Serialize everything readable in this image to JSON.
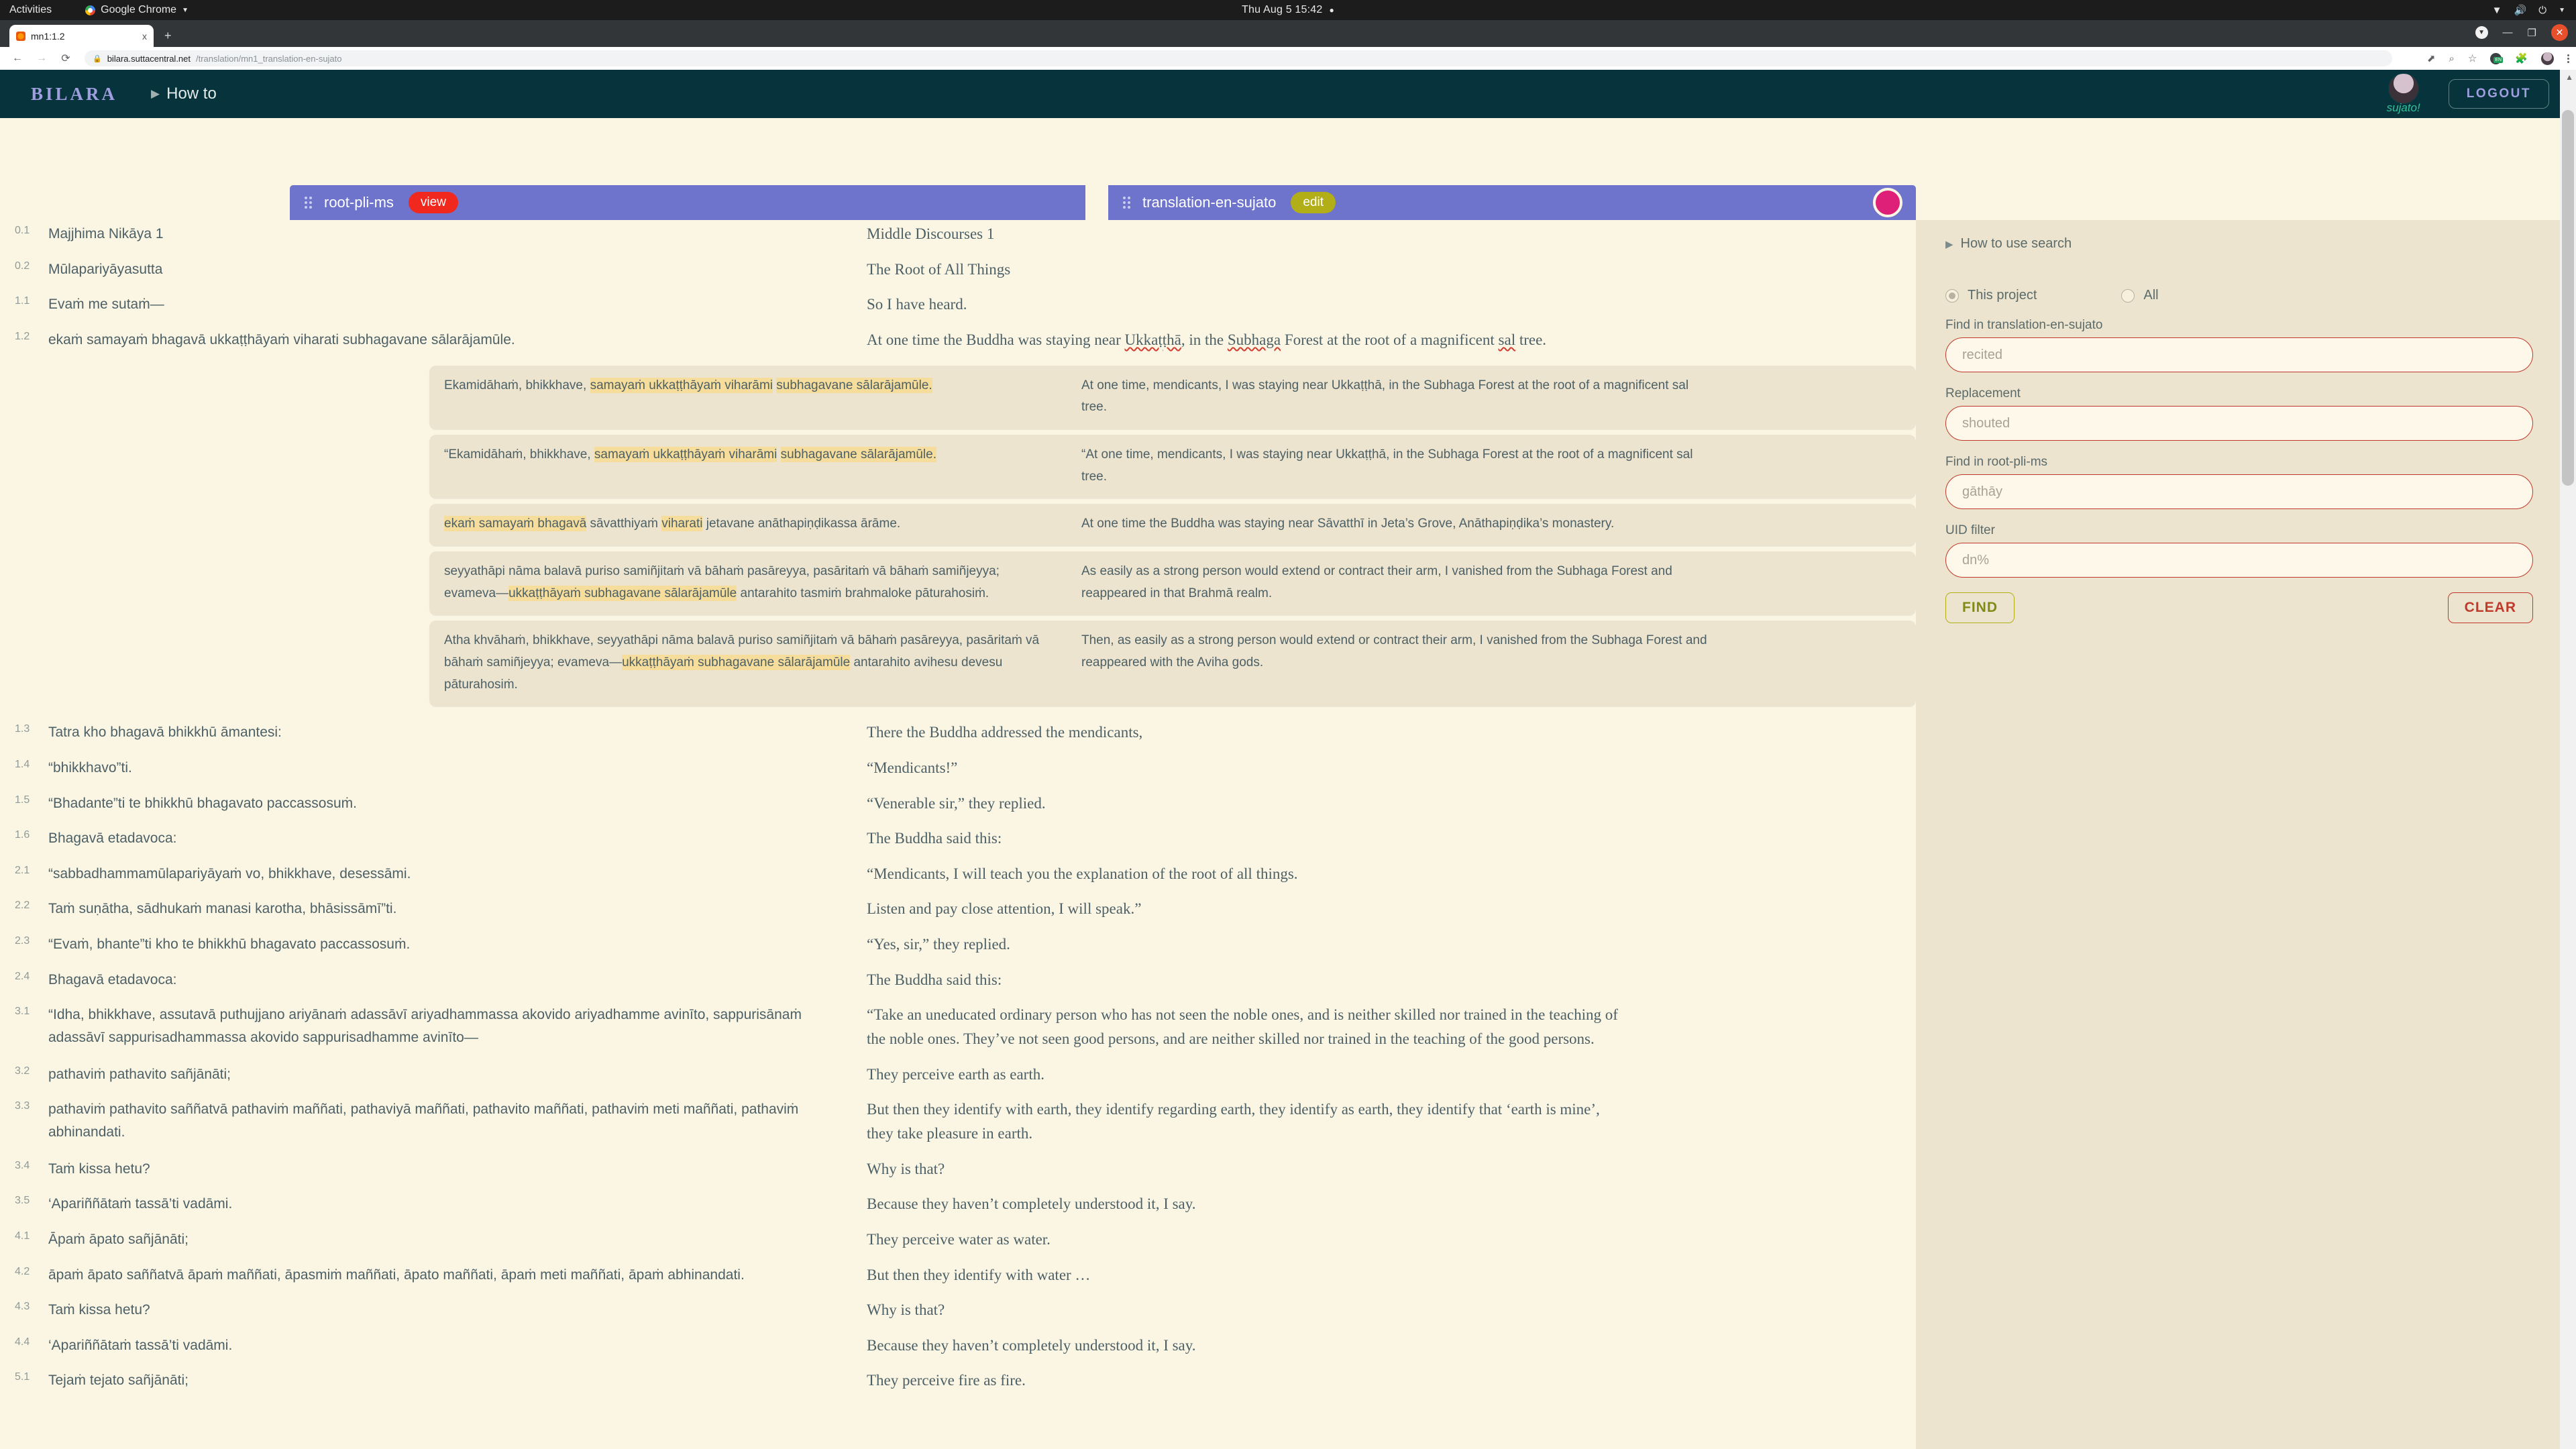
{
  "os": {
    "activities": "Activities",
    "app_menu": "Google Chrome",
    "clock": "Thu Aug 5  15:42",
    "icons": {
      "wifi": "wifi-icon",
      "volume": "volume-icon",
      "power": "power-icon",
      "chevron": "chevron-down-icon"
    }
  },
  "browser": {
    "tab_title": "mn1:1.2",
    "tab_close": "x",
    "new_tab": "+",
    "url_host": "bilara.suttacentral.net",
    "url_path": "/translation/mn1_translation-en-sujato",
    "window": {
      "minimize": "—",
      "maximize": "❐",
      "close": "✕"
    }
  },
  "app": {
    "brand": "BILARA",
    "howto": "How to",
    "user_name": "sujato!",
    "logout_label": "LOGOUT"
  },
  "columns": {
    "left": {
      "title": "root-pli-ms",
      "badge": "view"
    },
    "right": {
      "title": "translation-en-sujato",
      "badge": "edit"
    }
  },
  "sidebar": {
    "howto_search": "How to use search",
    "scope": {
      "this_project": "This project",
      "all": "All",
      "selected": "This project"
    },
    "find_translation_label": "Find in translation-en-sujato",
    "find_translation_placeholder": "recited",
    "replacement_label": "Replacement",
    "replacement_placeholder": "shouted",
    "find_root_label": "Find in root-pli-ms",
    "find_root_placeholder": "gāthāy",
    "uid_label": "UID filter",
    "uid_placeholder": "dn%",
    "find_button": "FIND",
    "clear_button": "CLEAR"
  },
  "segments_top": [
    {
      "num": "0.1",
      "pli": "Majjhima Nikāya 1",
      "en": "Middle Discourses 1"
    },
    {
      "num": "0.2",
      "pli": "Mūlapariyāyasutta",
      "en": "The Root of All Things"
    },
    {
      "num": "1.1",
      "pli": "Evaṁ me sutaṁ—",
      "en": "So I have heard."
    },
    {
      "num": "1.2",
      "pli": "ekaṁ samayaṁ bhagavā ukkaṭṭhāyaṁ viharati subhagavane sālarājamūle.",
      "en": "At one time the Buddha was staying near Ukkaṭṭhā, in the Subhaga Forest at the root of a magnificent sal tree."
    }
  ],
  "search_results": [
    {
      "pli_parts": [
        {
          "t": "Ekamidāhaṁ, bhikkhave, ",
          "hl": false
        },
        {
          "t": "samayaṁ ukkaṭṭhāyaṁ viharāmi",
          "hl": true
        },
        {
          "t": " ",
          "hl": false
        },
        {
          "t": "subhagavane sālarājamūle.",
          "hl": true
        }
      ],
      "en": "At one time, mendicants, I was staying near Ukkaṭṭhā, in the Subhaga Forest at the root of a magnificent sal tree."
    },
    {
      "pli_parts": [
        {
          "t": "“Ekamidāhaṁ, bhikkhave, ",
          "hl": false
        },
        {
          "t": "samayaṁ ukkaṭṭhāyaṁ viharāmi",
          "hl": true
        },
        {
          "t": " ",
          "hl": false
        },
        {
          "t": "subhagavane sālarājamūle.",
          "hl": true
        }
      ],
      "en": "“At one time, mendicants, I was staying near Ukkaṭṭhā, in the Subhaga Forest at the root of a magnificent sal tree."
    },
    {
      "pli_parts": [
        {
          "t": "ekaṁ samayaṁ bhagavā",
          "hl": true
        },
        {
          "t": " sāvatthiyaṁ ",
          "hl": false
        },
        {
          "t": "viharati",
          "hl": true
        },
        {
          "t": " jetavane anāthapiṇḍikassa ārāme.",
          "hl": false
        }
      ],
      "en": "At one time the Buddha was staying near Sāvatthī in Jeta’s Grove, Anāthapiṇḍika’s monastery."
    },
    {
      "pli_parts": [
        {
          "t": "seyyathāpi nāma balavā puriso samiñjitaṁ vā bāhaṁ pasāreyya, pasāritaṁ vā bāhaṁ samiñjeyya; evameva—",
          "hl": false
        },
        {
          "t": "ukkaṭṭhāyaṁ subhagavane sālarājamūle",
          "hl": true
        },
        {
          "t": " antarahito tasmiṁ brahmaloke pāturahosiṁ.",
          "hl": false
        }
      ],
      "en": "As easily as a strong person would extend or contract their arm, I vanished from the Subhaga Forest and reappeared in that Brahmā realm."
    },
    {
      "pli_parts": [
        {
          "t": "Atha khvāhaṁ, bhikkhave, seyyathāpi nāma balavā puriso samiñjitaṁ vā bāhaṁ pasāreyya, pasāritaṁ vā bāhaṁ samiñjeyya; evameva—",
          "hl": false
        },
        {
          "t": "ukkaṭṭhāyaṁ subhagavane sālarājamūle",
          "hl": true
        },
        {
          "t": " antarahito avihesu devesu pāturahosiṁ.",
          "hl": false
        }
      ],
      "en": "Then, as easily as a strong person would extend or contract their arm, I vanished from the Subhaga Forest and reappeared with the Aviha gods."
    }
  ],
  "segments_bottom": [
    {
      "num": "1.3",
      "pli": "Tatra kho bhagavā bhikkhū āmantesi:",
      "en": "There the Buddha addressed the mendicants,"
    },
    {
      "num": "1.4",
      "pli": "“bhikkhavo”ti.",
      "en": "“Mendicants!”"
    },
    {
      "num": "1.5",
      "pli": "“Bhadante”ti te bhikkhū bhagavato paccassosuṁ.",
      "en": "“Venerable sir,” they replied."
    },
    {
      "num": "1.6",
      "pli": "Bhagavā etadavoca:",
      "en": "The Buddha said this:"
    },
    {
      "num": "2.1",
      "pli": "“sabbadhammamūlapariyāyaṁ vo, bhikkhave, desessāmi.",
      "en": "“Mendicants, I will teach you the explanation of the root of all things."
    },
    {
      "num": "2.2",
      "pli": "Taṁ suṇātha, sādhukaṁ manasi karotha, bhāsissāmī”ti.",
      "en": "Listen and pay close attention, I will speak.”"
    },
    {
      "num": "2.3",
      "pli": "“Evaṁ, bhante”ti kho te bhikkhū bhagavato paccassosuṁ.",
      "en": "“Yes, sir,” they replied."
    },
    {
      "num": "2.4",
      "pli": "Bhagavā etadavoca:",
      "en": "The Buddha said this:"
    },
    {
      "num": "3.1",
      "pli": "“Idha, bhikkhave, assutavā puthujjano ariyānaṁ adassāvī ariyadhammassa akovido ariyadhamme avinīto, sappurisānaṁ adassāvī sappurisadhammassa akovido sappurisadhamme avinīto—",
      "en": "“Take an uneducated ordinary person who has not seen the noble ones, and is neither skilled nor trained in the teaching of the noble ones. They’ve not seen good persons, and are neither skilled nor trained in the teaching of the good persons."
    },
    {
      "num": "3.2",
      "pli": "pathaviṁ pathavito sañjānāti;",
      "en": "They perceive earth as earth."
    },
    {
      "num": "3.3",
      "pli": "pathaviṁ pathavito saññatvā pathaviṁ maññati, pathaviyā maññati, pathavito maññati, pathaviṁ meti maññati, pathaviṁ abhinandati.",
      "en": "But then they identify with earth, they identify regarding earth, they identify as earth, they identify that ‘earth is mine’, they take pleasure in earth."
    },
    {
      "num": "3.4",
      "pli": "Taṁ kissa hetu?",
      "en": "Why is that?"
    },
    {
      "num": "3.5",
      "pli": "‘Apariññātaṁ tassā’ti vadāmi.",
      "en": "Because they haven’t completely understood it, I say."
    },
    {
      "num": "4.1",
      "pli": "Āpaṁ āpato sañjānāti;",
      "en": "They perceive water as water."
    },
    {
      "num": "4.2",
      "pli": "āpaṁ āpato saññatvā āpaṁ maññati, āpasmiṁ maññati, āpato maññati, āpaṁ meti maññati, āpaṁ abhinandati.",
      "en": "But then they identify with water …"
    },
    {
      "num": "4.3",
      "pli": "Taṁ kissa hetu?",
      "en": "Why is that?"
    },
    {
      "num": "4.4",
      "pli": "‘Apariññātaṁ tassā’ti vadāmi.",
      "en": "Because they haven’t completely understood it, I say."
    },
    {
      "num": "5.1",
      "pli": "Tejaṁ tejato sañjānāti;",
      "en": "They perceive fire as fire."
    }
  ]
}
